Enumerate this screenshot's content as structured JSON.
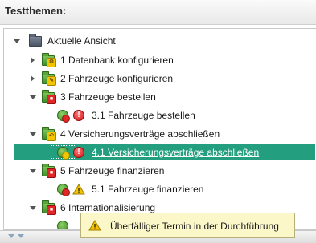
{
  "header": {
    "title": "Testthemen:"
  },
  "tree": {
    "root": {
      "label": "Aktuelle Ansicht"
    },
    "items": [
      {
        "label": "1 Datenbank konfigurieren"
      },
      {
        "label": "2 Fahrzeuge konfigurieren"
      },
      {
        "label": "3 Fahrzeuge bestellen"
      },
      {
        "label": "3.1 Fahrzeuge bestellen"
      },
      {
        "label": "4 Versicherungsverträge abschließen"
      },
      {
        "label": "4.1 Versicherungsverträge abschließen"
      },
      {
        "label": "5 Fahrzeuge finanzieren"
      },
      {
        "label": "5.1 Fahrzeuge finanzieren"
      },
      {
        "label": "6 Internationalisierung"
      }
    ]
  },
  "tooltip": {
    "text": "Überfälliger Termin in der Durchführung"
  },
  "icons": {
    "root": "folder-view-icon",
    "theme": "test-theme-folder-icon",
    "test": "test-case-icon",
    "error": "error-status-icon",
    "warning": "warning-status-icon"
  },
  "colors": {
    "selection": "#239e7e",
    "tooltip_bg": "#fbf7c9",
    "error": "#e02626",
    "warning": "#f3c400"
  }
}
